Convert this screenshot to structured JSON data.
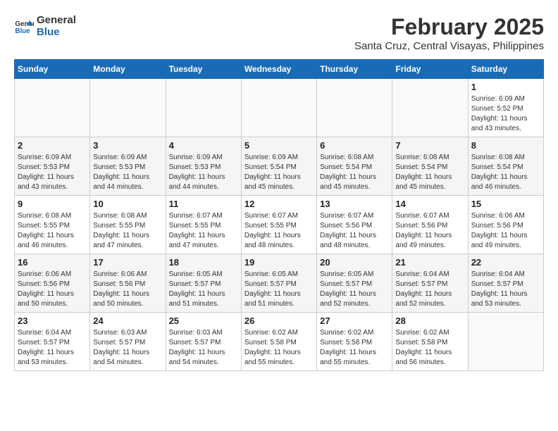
{
  "header": {
    "logo_line1": "General",
    "logo_line2": "Blue",
    "month": "February 2025",
    "location": "Santa Cruz, Central Visayas, Philippines"
  },
  "weekdays": [
    "Sunday",
    "Monday",
    "Tuesday",
    "Wednesday",
    "Thursday",
    "Friday",
    "Saturday"
  ],
  "weeks": [
    [
      {
        "day": "",
        "info": ""
      },
      {
        "day": "",
        "info": ""
      },
      {
        "day": "",
        "info": ""
      },
      {
        "day": "",
        "info": ""
      },
      {
        "day": "",
        "info": ""
      },
      {
        "day": "",
        "info": ""
      },
      {
        "day": "1",
        "info": "Sunrise: 6:09 AM\nSunset: 5:52 PM\nDaylight: 11 hours and 43 minutes."
      }
    ],
    [
      {
        "day": "2",
        "info": "Sunrise: 6:09 AM\nSunset: 5:53 PM\nDaylight: 11 hours and 43 minutes."
      },
      {
        "day": "3",
        "info": "Sunrise: 6:09 AM\nSunset: 5:53 PM\nDaylight: 11 hours and 44 minutes."
      },
      {
        "day": "4",
        "info": "Sunrise: 6:09 AM\nSunset: 5:53 PM\nDaylight: 11 hours and 44 minutes."
      },
      {
        "day": "5",
        "info": "Sunrise: 6:09 AM\nSunset: 5:54 PM\nDaylight: 11 hours and 45 minutes."
      },
      {
        "day": "6",
        "info": "Sunrise: 6:08 AM\nSunset: 5:54 PM\nDaylight: 11 hours and 45 minutes."
      },
      {
        "day": "7",
        "info": "Sunrise: 6:08 AM\nSunset: 5:54 PM\nDaylight: 11 hours and 45 minutes."
      },
      {
        "day": "8",
        "info": "Sunrise: 6:08 AM\nSunset: 5:54 PM\nDaylight: 11 hours and 46 minutes."
      }
    ],
    [
      {
        "day": "9",
        "info": "Sunrise: 6:08 AM\nSunset: 5:55 PM\nDaylight: 11 hours and 46 minutes."
      },
      {
        "day": "10",
        "info": "Sunrise: 6:08 AM\nSunset: 5:55 PM\nDaylight: 11 hours and 47 minutes."
      },
      {
        "day": "11",
        "info": "Sunrise: 6:07 AM\nSunset: 5:55 PM\nDaylight: 11 hours and 47 minutes."
      },
      {
        "day": "12",
        "info": "Sunrise: 6:07 AM\nSunset: 5:55 PM\nDaylight: 11 hours and 48 minutes."
      },
      {
        "day": "13",
        "info": "Sunrise: 6:07 AM\nSunset: 5:56 PM\nDaylight: 11 hours and 48 minutes."
      },
      {
        "day": "14",
        "info": "Sunrise: 6:07 AM\nSunset: 5:56 PM\nDaylight: 11 hours and 49 minutes."
      },
      {
        "day": "15",
        "info": "Sunrise: 6:06 AM\nSunset: 5:56 PM\nDaylight: 11 hours and 49 minutes."
      }
    ],
    [
      {
        "day": "16",
        "info": "Sunrise: 6:06 AM\nSunset: 5:56 PM\nDaylight: 11 hours and 50 minutes."
      },
      {
        "day": "17",
        "info": "Sunrise: 6:06 AM\nSunset: 5:56 PM\nDaylight: 11 hours and 50 minutes."
      },
      {
        "day": "18",
        "info": "Sunrise: 6:05 AM\nSunset: 5:57 PM\nDaylight: 11 hours and 51 minutes."
      },
      {
        "day": "19",
        "info": "Sunrise: 6:05 AM\nSunset: 5:57 PM\nDaylight: 11 hours and 51 minutes."
      },
      {
        "day": "20",
        "info": "Sunrise: 6:05 AM\nSunset: 5:57 PM\nDaylight: 11 hours and 52 minutes."
      },
      {
        "day": "21",
        "info": "Sunrise: 6:04 AM\nSunset: 5:57 PM\nDaylight: 11 hours and 52 minutes."
      },
      {
        "day": "22",
        "info": "Sunrise: 6:04 AM\nSunset: 5:57 PM\nDaylight: 11 hours and 53 minutes."
      }
    ],
    [
      {
        "day": "23",
        "info": "Sunrise: 6:04 AM\nSunset: 5:57 PM\nDaylight: 11 hours and 53 minutes."
      },
      {
        "day": "24",
        "info": "Sunrise: 6:03 AM\nSunset: 5:57 PM\nDaylight: 11 hours and 54 minutes."
      },
      {
        "day": "25",
        "info": "Sunrise: 6:03 AM\nSunset: 5:57 PM\nDaylight: 11 hours and 54 minutes."
      },
      {
        "day": "26",
        "info": "Sunrise: 6:02 AM\nSunset: 5:58 PM\nDaylight: 11 hours and 55 minutes."
      },
      {
        "day": "27",
        "info": "Sunrise: 6:02 AM\nSunset: 5:58 PM\nDaylight: 11 hours and 55 minutes."
      },
      {
        "day": "28",
        "info": "Sunrise: 6:02 AM\nSunset: 5:58 PM\nDaylight: 11 hours and 56 minutes."
      },
      {
        "day": "",
        "info": ""
      }
    ]
  ]
}
